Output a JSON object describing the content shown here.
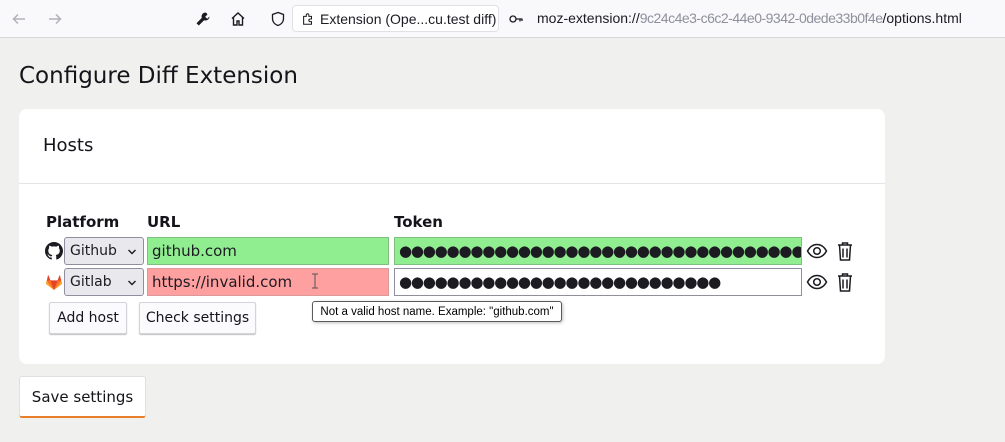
{
  "browser": {
    "tab_title": "Extension (Ope...cu.test diff)",
    "url_prefix": "moz-extension://",
    "url_obscured": "9c24c4e3-c6c2-44e0-9342-0dede33b0f4e",
    "url_suffix": "/options.html"
  },
  "page": {
    "title": "Configure Diff Extension"
  },
  "hosts": {
    "title": "Hosts",
    "columns": {
      "platform": "Platform",
      "url": "URL",
      "token": "Token"
    },
    "rows": [
      {
        "platform": "Github",
        "platform_icon": "github-icon",
        "url": "github.com",
        "token": "●●●●●●●●●●●●●●●●●●●●●●●●●●●●●●●●●●●●●●●●",
        "status": "valid"
      },
      {
        "platform": "Gitlab",
        "platform_icon": "gitlab-icon",
        "url": "https://invalid.com",
        "token": "●●●●●●●●●●●●●●●●●●●●●●●●●●●",
        "status": "invalid"
      }
    ],
    "add_host_label": "Add host",
    "check_settings_label": "Check settings",
    "tooltip": "Not a valid host name. Example: \"github.com\""
  },
  "save_label": "Save settings",
  "colors": {
    "valid": "#90ee90",
    "invalid": "#ffa0a0",
    "accent": "#e97f2b",
    "gitlab": "#e24329"
  }
}
